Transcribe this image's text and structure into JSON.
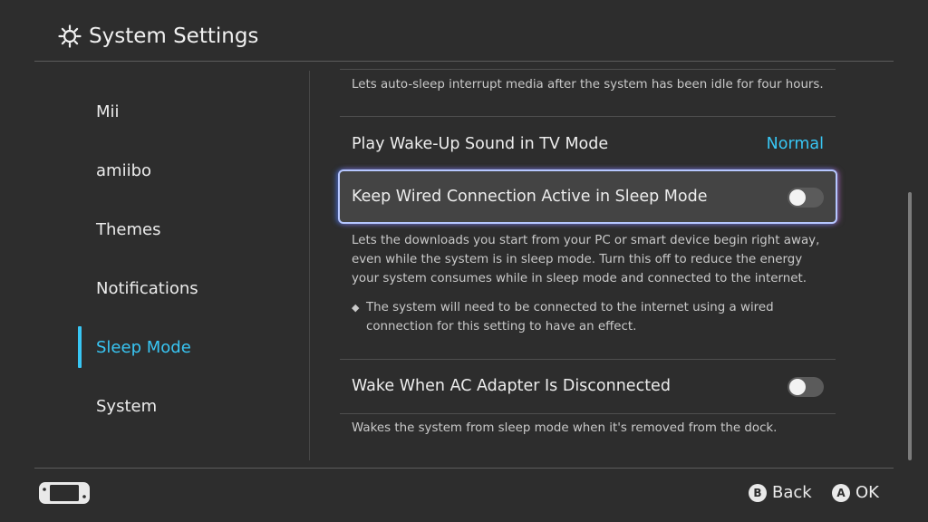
{
  "header": {
    "title": "System Settings",
    "icon": "gear-icon"
  },
  "sidebar": {
    "items": [
      {
        "label": "Mii",
        "selected": false
      },
      {
        "label": "amiibo",
        "selected": false
      },
      {
        "label": "Themes",
        "selected": false
      },
      {
        "label": "Notifications",
        "selected": false
      },
      {
        "label": "Sleep Mode",
        "selected": true
      },
      {
        "label": "System",
        "selected": false
      }
    ]
  },
  "content": {
    "top_description": "Lets auto-sleep interrupt media after the system has been idle for four hours.",
    "settings": [
      {
        "label": "Play Wake-Up Sound in TV Mode",
        "value": "Normal"
      },
      {
        "label": "Keep Wired Connection Active in Sleep Mode",
        "toggle": "off",
        "focused": true,
        "description": "Lets the downloads you start from your PC or smart device begin right away, even while the system is in sleep mode. Turn this off to reduce the energy your system consumes while in sleep mode and connected to the internet.",
        "note": "The system will need to be connected to the internet using a wired connection for this setting to have an effect."
      },
      {
        "label": "Wake When AC Adapter Is Disconnected",
        "toggle": "off",
        "description": "Wakes the system from sleep mode when it's removed from the dock."
      }
    ]
  },
  "footer": {
    "back": {
      "button": "B",
      "label": "Back"
    },
    "ok": {
      "button": "A",
      "label": "OK"
    }
  },
  "colors": {
    "background": "#2d2d2d",
    "accent": "#38c6f4",
    "text": "#ececec"
  }
}
